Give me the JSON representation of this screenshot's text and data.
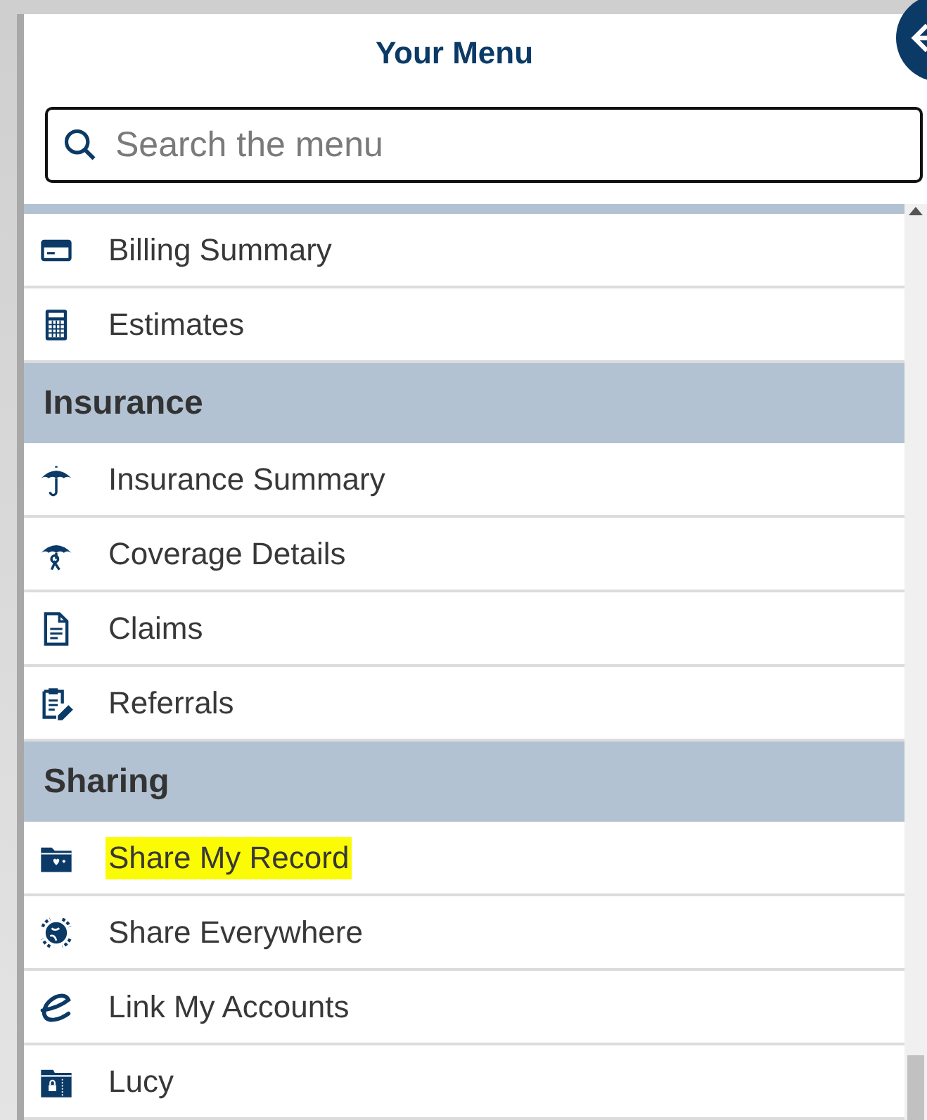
{
  "header": {
    "title": "Your Menu"
  },
  "search": {
    "placeholder": "Search the menu"
  },
  "menu": [
    {
      "kind": "item",
      "label": "Billing Summary",
      "highlighted": false
    },
    {
      "kind": "item",
      "label": "Estimates",
      "highlighted": false
    },
    {
      "kind": "heading",
      "label": "Insurance"
    },
    {
      "kind": "item",
      "label": "Insurance Summary",
      "highlighted": false
    },
    {
      "kind": "item",
      "label": "Coverage Details",
      "highlighted": false
    },
    {
      "kind": "item",
      "label": "Claims",
      "highlighted": false
    },
    {
      "kind": "item",
      "label": "Referrals",
      "highlighted": false
    },
    {
      "kind": "heading",
      "label": "Sharing"
    },
    {
      "kind": "item",
      "label": "Share My Record",
      "highlighted": true
    },
    {
      "kind": "item",
      "label": "Share Everywhere",
      "highlighted": false
    },
    {
      "kind": "item",
      "label": "Link My Accounts",
      "highlighted": false
    },
    {
      "kind": "item",
      "label": "Lucy",
      "highlighted": false
    }
  ]
}
